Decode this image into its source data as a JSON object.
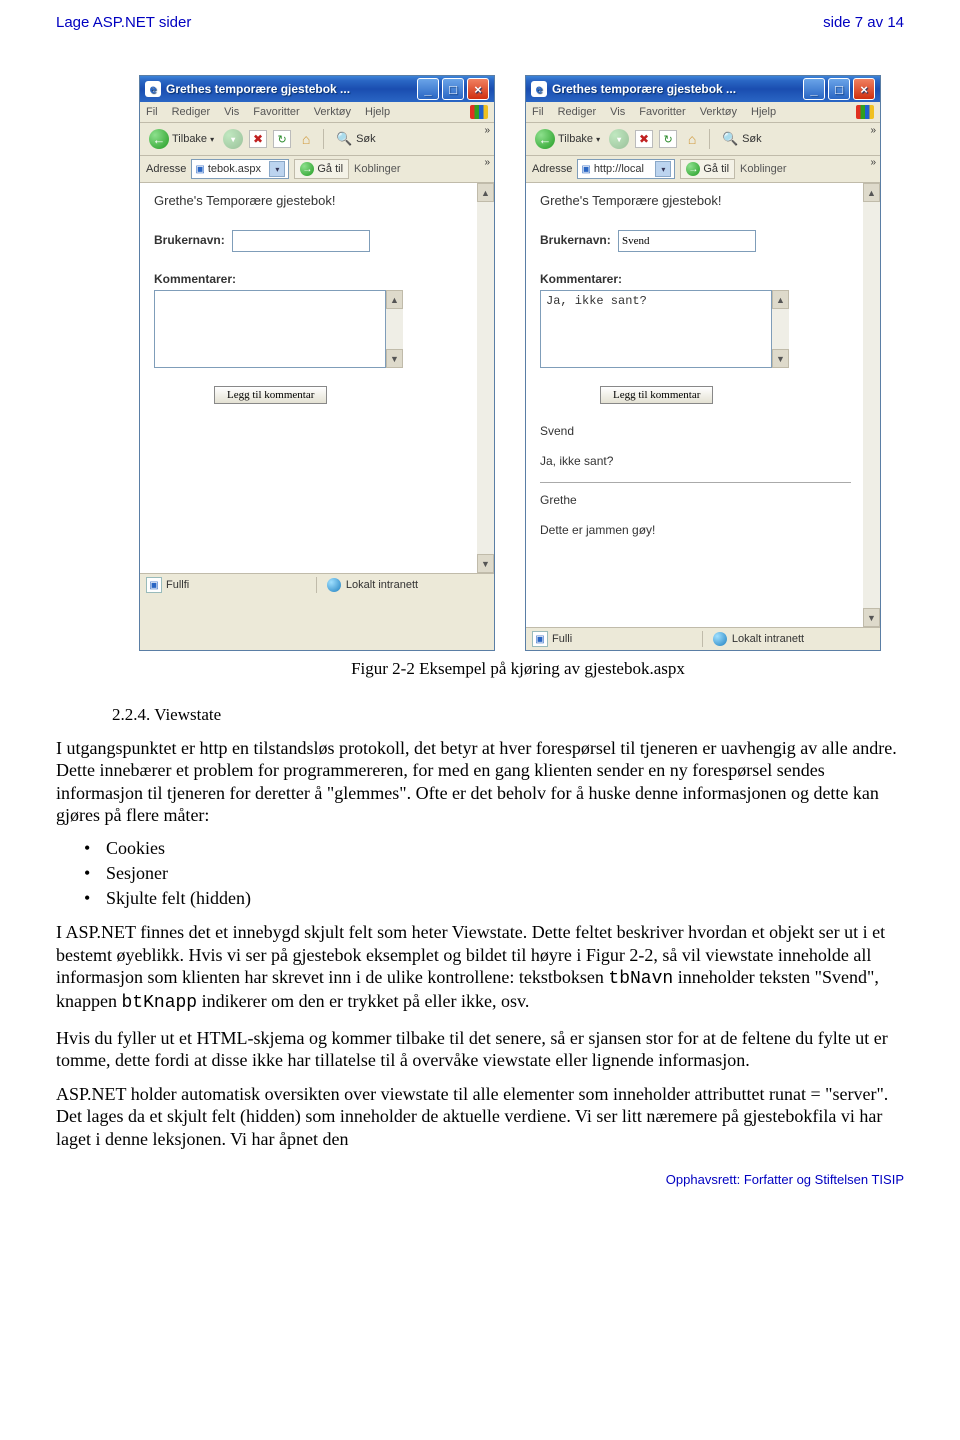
{
  "header": {
    "left": "Lage ASP.NET sider",
    "right": "side 7 av 14"
  },
  "browser_shared": {
    "menu": {
      "fil": "Fil",
      "rediger": "Rediger",
      "vis": "Vis",
      "favoritter": "Favoritter",
      "verktoy": "Verktøy",
      "hjelp": "Hjelp"
    },
    "toolbar": {
      "back": "Tilbake",
      "search": "Søk"
    },
    "addrbar": {
      "label": "Adresse",
      "go": "Gå til",
      "links": "Koblinger"
    },
    "status": {
      "intranet": "Lokalt intranett"
    }
  },
  "win1": {
    "title": "Grethes temporære gjestebok ...",
    "url": "tebok.aspx",
    "page": {
      "heading": "Grethe's Temporære gjestebok!",
      "brukernavn_label": "Brukernavn:",
      "brukernavn_value": "",
      "kommentarer_label": "Kommentarer:",
      "kommentarer_value": "",
      "button": "Legg til kommentar"
    },
    "status_left": "Fullfi"
  },
  "win2": {
    "title": "Grethes temporære gjestebok ...",
    "url": "http://local",
    "page": {
      "heading": "Grethe's Temporære gjestebok!",
      "brukernavn_label": "Brukernavn:",
      "brukernavn_value": "Svend",
      "kommentarer_label": "Kommentarer:",
      "kommentarer_value": "Ja, ikke sant?",
      "button": "Legg til kommentar",
      "entries": [
        {
          "name": "Svend",
          "text": "Ja, ikke sant?"
        },
        {
          "name": "Grethe",
          "text": "Dette er jammen gøy!"
        }
      ]
    },
    "status_left": "Fulli"
  },
  "caption": "Figur 2-2 Eksempel på kjøring av gjestebok.aspx",
  "section_heading": "2.2.4. Viewstate",
  "p1": "I utgangspunktet er http en tilstandsløs protokoll, det betyr at hver forespørsel til tjeneren er uavhengig av alle andre. Dette innebærer et problem for programmereren, for med en gang klienten sender en ny forespørsel sendes informasjon til tjeneren for deretter å \"glemmes\". Ofte er det beholv for å huske denne informasjonen og dette kan gjøres på flere måter:",
  "bullets": {
    "b1": "Cookies",
    "b2": "Sesjoner",
    "b3": "Skjulte felt (hidden)"
  },
  "p2a": "I ASP.NET finnes det et innebygd skjult felt som heter Viewstate. Dette feltet beskriver hvordan et objekt ser ut i et bestemt øyeblikk. Hvis vi ser på gjestebok eksemplet og bildet til høyre i Figur 2-2, så vil viewstate inneholde all informasjon som klienten har skrevet inn i de ulike kontrollene: tekstboksen ",
  "p2b": " inneholder teksten \"Svend\", knappen ",
  "p2c": " indikerer om den er trykket på eller ikke, osv.",
  "code1": "tbNavn",
  "code2": "btKnapp",
  "p3": "Hvis du fyller ut et HTML-skjema og kommer tilbake til det senere, så er sjansen stor for at de feltene du fylte ut er tomme, dette fordi at disse ikke har tillatelse til å overvåke viewstate eller lignende informasjon.",
  "p4": "ASP.NET holder automatisk oversikten over viewstate til alle elementer som inneholder attributtet runat = \"server\". Det lages da et skjult felt (hidden) som inneholder de aktuelle verdiene. Vi ser litt næremere på gjestebokfila vi har laget i denne leksjonen. Vi har åpnet den",
  "footer": "Opphavsrett:  Forfatter og Stiftelsen TISIP"
}
